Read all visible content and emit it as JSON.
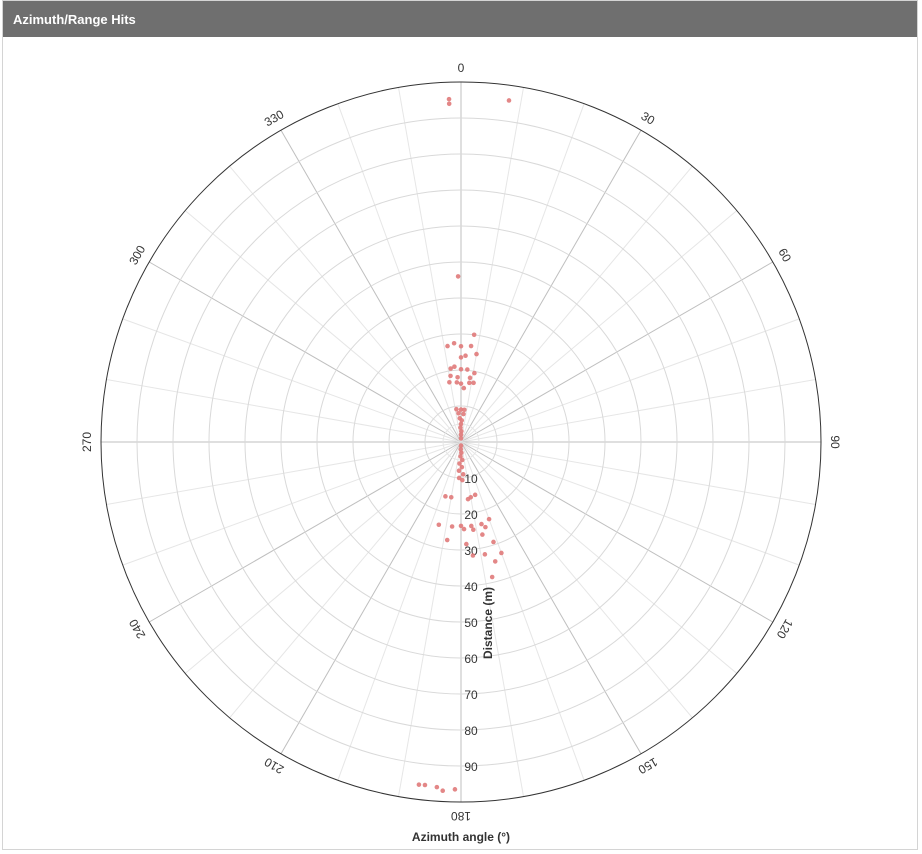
{
  "panel": {
    "title": "Azimuth/Range Hits"
  },
  "colors": {
    "header_bg": "#6f6f6f",
    "point": "#e07a7a",
    "grid": "#d9d9d9",
    "outer_ring": "#333333"
  },
  "chart_data": {
    "type": "scatter",
    "subtype": "polar",
    "theta_label": "Azimuth angle (°)",
    "r_label": "Distance (m)",
    "theta_ticks": [
      0,
      30,
      60,
      90,
      120,
      150,
      180,
      210,
      240,
      270,
      300,
      330
    ],
    "theta_direction": "clockwise",
    "theta_zero": "top",
    "r_ticks": [
      10,
      20,
      30,
      40,
      50,
      60,
      70,
      80,
      90
    ],
    "r_range": [
      0,
      100
    ],
    "grid": true,
    "points": [
      {
        "theta": 358,
        "r": 95.3
      },
      {
        "theta": 358,
        "r": 94.0
      },
      {
        "theta": 8,
        "r": 95.8
      },
      {
        "theta": 359,
        "r": 46.0
      },
      {
        "theta": 7,
        "r": 30.0
      },
      {
        "theta": 356,
        "r": 27.5
      },
      {
        "theta": 352,
        "r": 26.9
      },
      {
        "theta": 0,
        "r": 26.6
      },
      {
        "theta": 6,
        "r": 26.8
      },
      {
        "theta": 10,
        "r": 24.8
      },
      {
        "theta": 3,
        "r": 24.0
      },
      {
        "theta": 0,
        "r": 23.5
      },
      {
        "theta": 355,
        "r": 21.0
      },
      {
        "theta": 352,
        "r": 20.6
      },
      {
        "theta": 0,
        "r": 20.2
      },
      {
        "theta": 5,
        "r": 20.2
      },
      {
        "theta": 11,
        "r": 19.5
      },
      {
        "theta": 8,
        "r": 18.0
      },
      {
        "theta": 351,
        "r": 18.6
      },
      {
        "theta": 357,
        "r": 18.0
      },
      {
        "theta": 356,
        "r": 16.6
      },
      {
        "theta": 349,
        "r": 16.9
      },
      {
        "theta": 0,
        "r": 16.2
      },
      {
        "theta": 8,
        "r": 16.6
      },
      {
        "theta": 12,
        "r": 16.8
      },
      {
        "theta": 3,
        "r": 15.0
      },
      {
        "theta": 352,
        "r": 9.2
      },
      {
        "theta": 0,
        "r": 9.0
      },
      {
        "theta": 6,
        "r": 9.0
      },
      {
        "theta": 355,
        "r": 8.0
      },
      {
        "theta": 5,
        "r": 7.8
      },
      {
        "theta": 357,
        "r": 6.6
      },
      {
        "theta": 2,
        "r": 6.0
      },
      {
        "theta": 0,
        "r": 5.0
      },
      {
        "theta": 358,
        "r": 4.0
      },
      {
        "theta": 2,
        "r": 3.0
      },
      {
        "theta": 0,
        "r": 2.0
      },
      {
        "theta": 0,
        "r": 1.0
      },
      {
        "theta": 180,
        "r": 1.0
      },
      {
        "theta": 182,
        "r": 2.0
      },
      {
        "theta": 178,
        "r": 3.0
      },
      {
        "theta": 182,
        "r": 4.0
      },
      {
        "theta": 176,
        "r": 5.0
      },
      {
        "theta": 184,
        "r": 6.0
      },
      {
        "theta": 178,
        "r": 7.0
      },
      {
        "theta": 184,
        "r": 8.0
      },
      {
        "theta": 176,
        "r": 9.0
      },
      {
        "theta": 183,
        "r": 10.0
      },
      {
        "theta": 178,
        "r": 10.6
      },
      {
        "theta": 170,
        "r": 15.6
      },
      {
        "theta": 165,
        "r": 15.2
      },
      {
        "theta": 190,
        "r": 15.6
      },
      {
        "theta": 196,
        "r": 15.7
      },
      {
        "theta": 173,
        "r": 16.0
      },
      {
        "theta": 195,
        "r": 23.8
      },
      {
        "theta": 186,
        "r": 23.6
      },
      {
        "theta": 180,
        "r": 23.3
      },
      {
        "theta": 173,
        "r": 23.5
      },
      {
        "theta": 166,
        "r": 23.5
      },
      {
        "theta": 160,
        "r": 22.8
      },
      {
        "theta": 164,
        "r": 24.6
      },
      {
        "theta": 172,
        "r": 24.6
      },
      {
        "theta": 178,
        "r": 24.2
      },
      {
        "theta": 167,
        "r": 26.4
      },
      {
        "theta": 188,
        "r": 27.5
      },
      {
        "theta": 177,
        "r": 28.4
      },
      {
        "theta": 162,
        "r": 29.2
      },
      {
        "theta": 168,
        "r": 31.9
      },
      {
        "theta": 174,
        "r": 31.7
      },
      {
        "theta": 164,
        "r": 34.5
      },
      {
        "theta": 160,
        "r": 32.8
      },
      {
        "theta": 167,
        "r": 38.5
      },
      {
        "theta": 183,
        "r": 97.0
      },
      {
        "theta": 187,
        "r": 95.9
      },
      {
        "theta": 186,
        "r": 95.8
      },
      {
        "theta": 184,
        "r": 96.1
      },
      {
        "theta": 181,
        "r": 96.5
      }
    ]
  }
}
